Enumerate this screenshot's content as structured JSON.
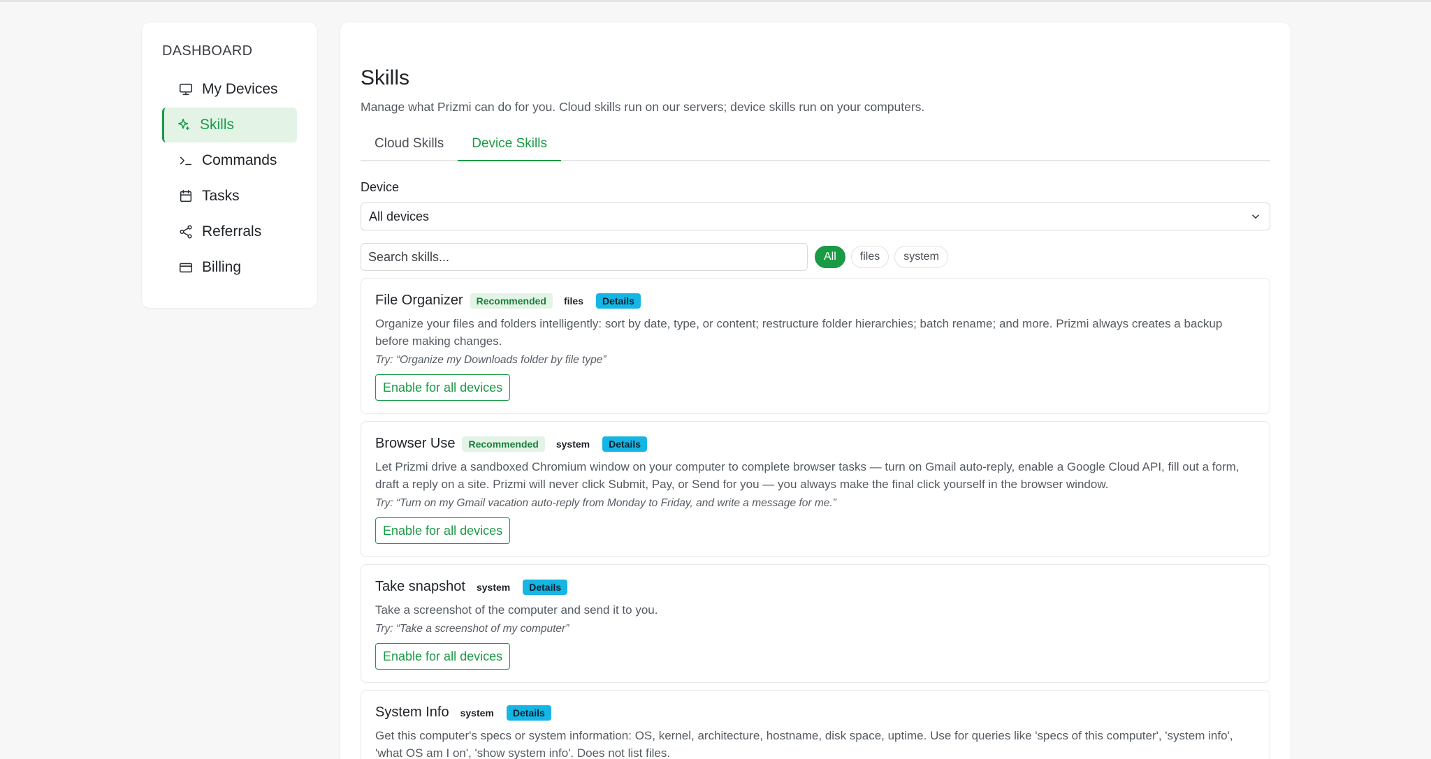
{
  "sidebar": {
    "heading": "DASHBOARD",
    "items": [
      {
        "label": "My Devices",
        "icon": "monitor-icon"
      },
      {
        "label": "Skills",
        "icon": "sparkle-icon",
        "active": true
      },
      {
        "label": "Commands",
        "icon": "terminal-icon"
      },
      {
        "label": "Tasks",
        "icon": "calendar-icon"
      },
      {
        "label": "Referrals",
        "icon": "share-icon"
      },
      {
        "label": "Billing",
        "icon": "credit-card-icon"
      }
    ]
  },
  "main": {
    "title": "Skills",
    "subtitle": "Manage what Prizmi can do for you. Cloud skills run on our servers; device skills run on your computers.",
    "tabs": [
      {
        "label": "Cloud Skills"
      },
      {
        "label": "Device Skills",
        "active": true
      }
    ],
    "device_label": "Device",
    "device_select_value": "All devices",
    "search_placeholder": "Search skills...",
    "filters": [
      {
        "label": "All",
        "active": true
      },
      {
        "label": "files"
      },
      {
        "label": "system"
      }
    ],
    "skills": [
      {
        "name": "File Organizer",
        "recommended": "Recommended",
        "tag": "files",
        "details": "Details",
        "description": "Organize your files and folders intelligently: sort by date, type, or content; restructure folder hierarchies; batch rename; and more. Prizmi always creates a backup before making changes.",
        "try": "Try: “Organize my Downloads folder by file type”",
        "button": "Enable for all devices"
      },
      {
        "name": "Browser Use",
        "recommended": "Recommended",
        "tag": "system",
        "details": "Details",
        "description": "Let Prizmi drive a sandboxed Chromium window on your computer to complete browser tasks — turn on Gmail auto-reply, enable a Google Cloud API, fill out a form, draft a reply on a site. Prizmi will never click Submit, Pay, or Send for you — you always make the final click yourself in the browser window.",
        "try": "Try: “Turn on my Gmail vacation auto-reply from Monday to Friday, and write a message for me.”",
        "button": "Enable for all devices"
      },
      {
        "name": "Take snapshot",
        "tag": "system",
        "details": "Details",
        "description": "Take a screenshot of the computer and send it to you.",
        "try": "Try: “Take a screenshot of my computer”",
        "button": "Enable for all devices"
      },
      {
        "name": "System Info",
        "tag": "system",
        "details": "Details",
        "description": "Get this computer's specs or system information: OS, kernel, architecture, hostname, disk space, uptime. Use for queries like 'specs of this computer', 'system info', 'what OS am I on', 'show system info'. Does not list files."
      }
    ]
  },
  "colors": {
    "accent": "#1a9a45",
    "accent_bg": "#e3f4e7",
    "details_badge": "#15b5e4"
  }
}
